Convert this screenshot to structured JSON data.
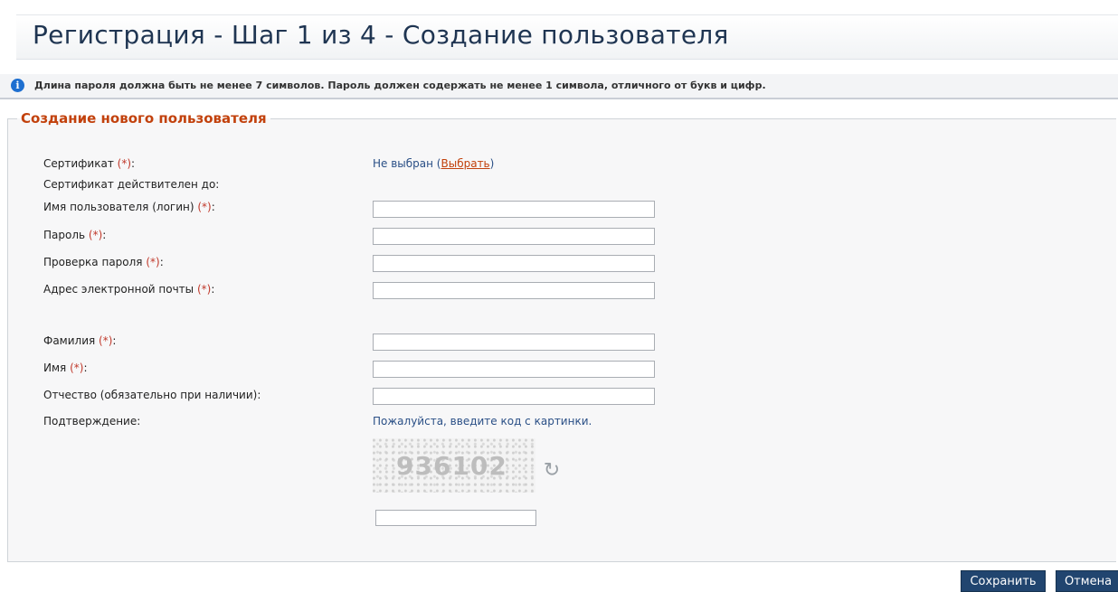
{
  "page": {
    "title": "Регистрация - Шаг 1 из 4 - Создание пользователя"
  },
  "info": {
    "icon": "info-icon",
    "text": "Длина пароля должна быть не менее 7 символов. Пароль должен содержать не менее 1 символа, отличного от букв и цифр."
  },
  "form": {
    "legend": "Создание нового пользователя",
    "required_marker": "(*)",
    "certificate": {
      "label": "Сертификат ",
      "value": "Не выбран (",
      "link": "Выбрать",
      "value_end": ")"
    },
    "certificate_valid": {
      "label": "Сертификат действителен до:"
    },
    "login": {
      "label": "Имя пользователя (логин) ",
      "value": ""
    },
    "password": {
      "label": "Пароль ",
      "value": ""
    },
    "password_confirm": {
      "label": "Проверка пароля ",
      "value": ""
    },
    "email": {
      "label": "Адрес электронной почты ",
      "value": ""
    },
    "surname": {
      "label": "Фамилия ",
      "value": ""
    },
    "name": {
      "label": "Имя ",
      "value": ""
    },
    "patronymic": {
      "label": "Отчество (обязательно при наличии):",
      "value": ""
    },
    "confirmation": {
      "label": "Подтверждение:",
      "hint": "Пожалуйста, введите код с картинки.",
      "captcha_code": "936102",
      "value": ""
    }
  },
  "buttons": {
    "save": "Сохранить",
    "cancel": "Отмена"
  },
  "colors": {
    "title": "#1f3552",
    "legend": "#c2410c",
    "required": "#c0392b",
    "button_bg": "#21456f",
    "info_icon": "#1e6fd0"
  }
}
